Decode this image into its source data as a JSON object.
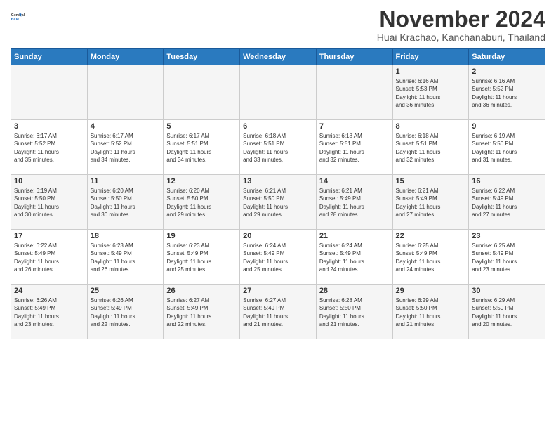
{
  "logo": {
    "line1": "General",
    "line2": "Blue"
  },
  "title": "November 2024",
  "subtitle": "Huai Krachao, Kanchanaburi, Thailand",
  "days_of_week": [
    "Sunday",
    "Monday",
    "Tuesday",
    "Wednesday",
    "Thursday",
    "Friday",
    "Saturday"
  ],
  "weeks": [
    [
      {
        "day": "",
        "info": ""
      },
      {
        "day": "",
        "info": ""
      },
      {
        "day": "",
        "info": ""
      },
      {
        "day": "",
        "info": ""
      },
      {
        "day": "",
        "info": ""
      },
      {
        "day": "1",
        "info": "Sunrise: 6:16 AM\nSunset: 5:53 PM\nDaylight: 11 hours\nand 36 minutes."
      },
      {
        "day": "2",
        "info": "Sunrise: 6:16 AM\nSunset: 5:52 PM\nDaylight: 11 hours\nand 36 minutes."
      }
    ],
    [
      {
        "day": "3",
        "info": "Sunrise: 6:17 AM\nSunset: 5:52 PM\nDaylight: 11 hours\nand 35 minutes."
      },
      {
        "day": "4",
        "info": "Sunrise: 6:17 AM\nSunset: 5:52 PM\nDaylight: 11 hours\nand 34 minutes."
      },
      {
        "day": "5",
        "info": "Sunrise: 6:17 AM\nSunset: 5:51 PM\nDaylight: 11 hours\nand 34 minutes."
      },
      {
        "day": "6",
        "info": "Sunrise: 6:18 AM\nSunset: 5:51 PM\nDaylight: 11 hours\nand 33 minutes."
      },
      {
        "day": "7",
        "info": "Sunrise: 6:18 AM\nSunset: 5:51 PM\nDaylight: 11 hours\nand 32 minutes."
      },
      {
        "day": "8",
        "info": "Sunrise: 6:18 AM\nSunset: 5:51 PM\nDaylight: 11 hours\nand 32 minutes."
      },
      {
        "day": "9",
        "info": "Sunrise: 6:19 AM\nSunset: 5:50 PM\nDaylight: 11 hours\nand 31 minutes."
      }
    ],
    [
      {
        "day": "10",
        "info": "Sunrise: 6:19 AM\nSunset: 5:50 PM\nDaylight: 11 hours\nand 30 minutes."
      },
      {
        "day": "11",
        "info": "Sunrise: 6:20 AM\nSunset: 5:50 PM\nDaylight: 11 hours\nand 30 minutes."
      },
      {
        "day": "12",
        "info": "Sunrise: 6:20 AM\nSunset: 5:50 PM\nDaylight: 11 hours\nand 29 minutes."
      },
      {
        "day": "13",
        "info": "Sunrise: 6:21 AM\nSunset: 5:50 PM\nDaylight: 11 hours\nand 29 minutes."
      },
      {
        "day": "14",
        "info": "Sunrise: 6:21 AM\nSunset: 5:49 PM\nDaylight: 11 hours\nand 28 minutes."
      },
      {
        "day": "15",
        "info": "Sunrise: 6:21 AM\nSunset: 5:49 PM\nDaylight: 11 hours\nand 27 minutes."
      },
      {
        "day": "16",
        "info": "Sunrise: 6:22 AM\nSunset: 5:49 PM\nDaylight: 11 hours\nand 27 minutes."
      }
    ],
    [
      {
        "day": "17",
        "info": "Sunrise: 6:22 AM\nSunset: 5:49 PM\nDaylight: 11 hours\nand 26 minutes."
      },
      {
        "day": "18",
        "info": "Sunrise: 6:23 AM\nSunset: 5:49 PM\nDaylight: 11 hours\nand 26 minutes."
      },
      {
        "day": "19",
        "info": "Sunrise: 6:23 AM\nSunset: 5:49 PM\nDaylight: 11 hours\nand 25 minutes."
      },
      {
        "day": "20",
        "info": "Sunrise: 6:24 AM\nSunset: 5:49 PM\nDaylight: 11 hours\nand 25 minutes."
      },
      {
        "day": "21",
        "info": "Sunrise: 6:24 AM\nSunset: 5:49 PM\nDaylight: 11 hours\nand 24 minutes."
      },
      {
        "day": "22",
        "info": "Sunrise: 6:25 AM\nSunset: 5:49 PM\nDaylight: 11 hours\nand 24 minutes."
      },
      {
        "day": "23",
        "info": "Sunrise: 6:25 AM\nSunset: 5:49 PM\nDaylight: 11 hours\nand 23 minutes."
      }
    ],
    [
      {
        "day": "24",
        "info": "Sunrise: 6:26 AM\nSunset: 5:49 PM\nDaylight: 11 hours\nand 23 minutes."
      },
      {
        "day": "25",
        "info": "Sunrise: 6:26 AM\nSunset: 5:49 PM\nDaylight: 11 hours\nand 22 minutes."
      },
      {
        "day": "26",
        "info": "Sunrise: 6:27 AM\nSunset: 5:49 PM\nDaylight: 11 hours\nand 22 minutes."
      },
      {
        "day": "27",
        "info": "Sunrise: 6:27 AM\nSunset: 5:49 PM\nDaylight: 11 hours\nand 21 minutes."
      },
      {
        "day": "28",
        "info": "Sunrise: 6:28 AM\nSunset: 5:50 PM\nDaylight: 11 hours\nand 21 minutes."
      },
      {
        "day": "29",
        "info": "Sunrise: 6:29 AM\nSunset: 5:50 PM\nDaylight: 11 hours\nand 21 minutes."
      },
      {
        "day": "30",
        "info": "Sunrise: 6:29 AM\nSunset: 5:50 PM\nDaylight: 11 hours\nand 20 minutes."
      }
    ]
  ]
}
